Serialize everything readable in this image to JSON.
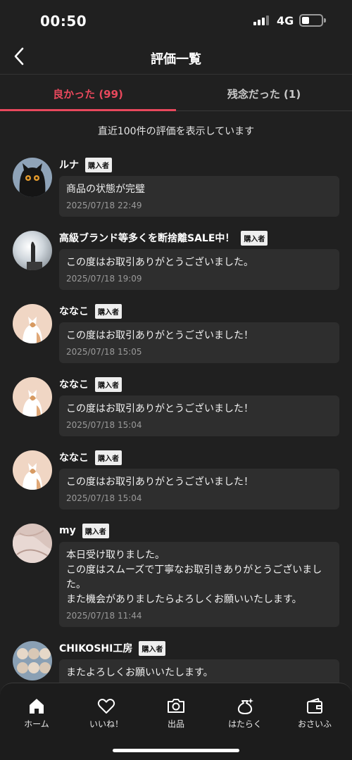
{
  "status_bar": {
    "time": "00:50",
    "network": "4G"
  },
  "header": {
    "title": "評価一覧",
    "back_icon": "chevron-left-icon"
  },
  "tabs": [
    {
      "label": "良かった (99)",
      "active": true
    },
    {
      "label": "残念だった (1)",
      "active": false
    }
  ],
  "notice": "直近100件の評価を表示しています",
  "badge_label": "購入者",
  "reviews": [
    {
      "name": "ルナ",
      "comment": "商品の状態が完璧",
      "date": "2025/07/18 22:49",
      "avatar": "black-cat"
    },
    {
      "name": "高級ブランド等多くを断捨離SALE中！",
      "comment": "この度はお取引ありがとうございました。",
      "date": "2025/07/18 19:09",
      "avatar": "tower-sunset"
    },
    {
      "name": "ななこ",
      "comment": "この度はお取引ありがとうございました！",
      "date": "2025/07/18 15:05",
      "avatar": "cat-illustration"
    },
    {
      "name": "ななこ",
      "comment": "この度はお取引ありがとうございました！",
      "date": "2025/07/18 15:04",
      "avatar": "cat-illustration"
    },
    {
      "name": "ななこ",
      "comment": "この度はお取引ありがとうございました！",
      "date": "2025/07/18 15:04",
      "avatar": "cat-illustration"
    },
    {
      "name": "my",
      "comment": "本日受け取りました。\nこの度はスムーズで丁寧なお取引きありがとうございました。\nまた機会がありましたらよろしくお願いいたします。",
      "date": "2025/07/18 11:44",
      "avatar": "fabric"
    },
    {
      "name": "CHIKOSHI工房",
      "comment": "またよろしくお願いいたします。",
      "date": "",
      "avatar": "dolls"
    }
  ],
  "bottom_nav": [
    {
      "label": "ホーム",
      "icon": "home-icon"
    },
    {
      "label": "いいね！",
      "icon": "heart-icon"
    },
    {
      "label": "出品",
      "icon": "camera-icon"
    },
    {
      "label": "はたらく",
      "icon": "money-bag-icon"
    },
    {
      "label": "おさいふ",
      "icon": "wallet-icon"
    }
  ],
  "colors": {
    "accent": "#e8485c",
    "background": "#202020",
    "bubble": "#2e2e2e"
  }
}
